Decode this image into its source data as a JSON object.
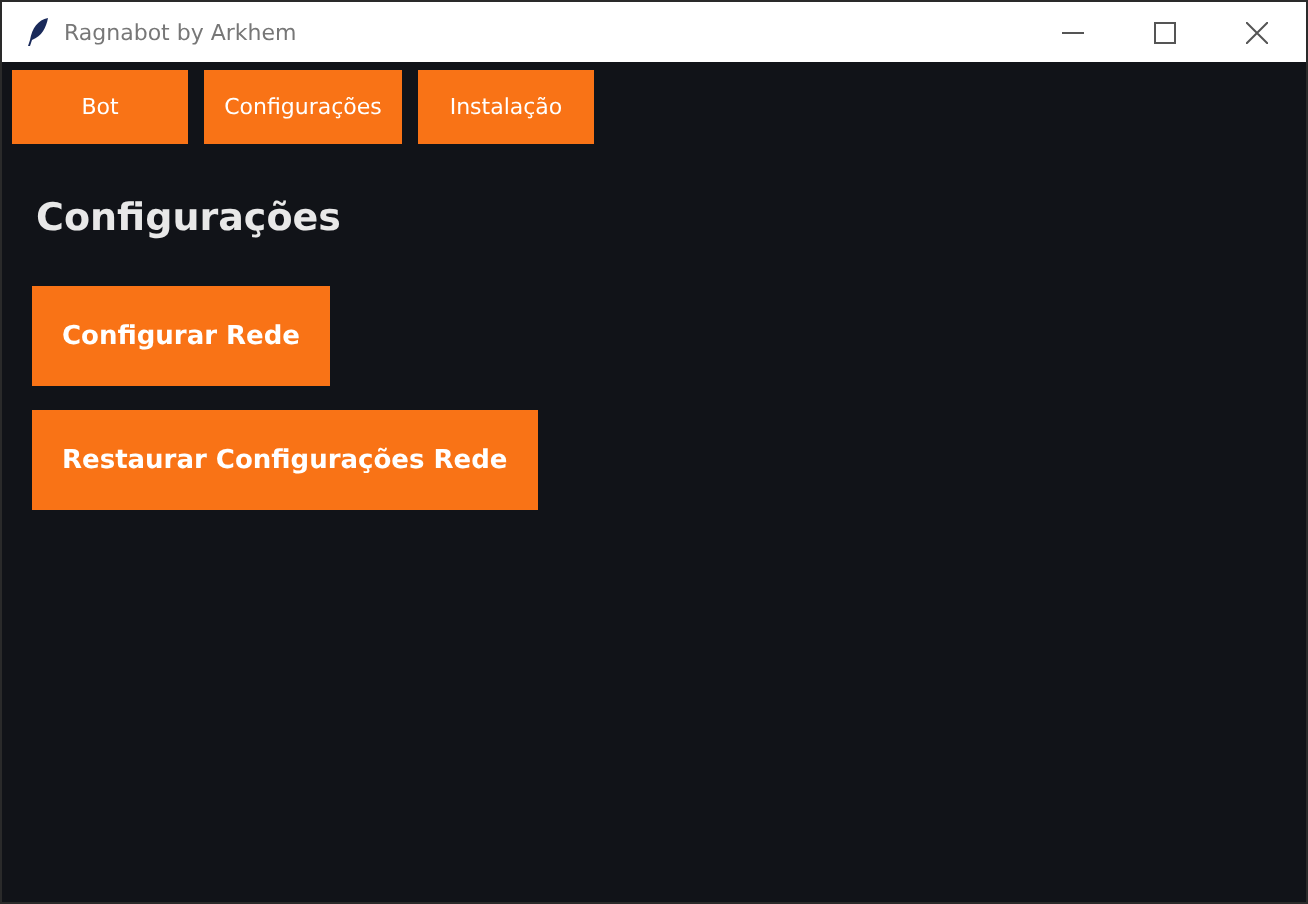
{
  "window": {
    "title": "Ragnabot by Arkhem"
  },
  "tabs": [
    {
      "label": "Bot"
    },
    {
      "label": "Configurações"
    },
    {
      "label": "Instalação"
    }
  ],
  "heading": "Configurações",
  "buttons": [
    {
      "label": "Configurar Rede"
    },
    {
      "label": "Restaurar Configurações Rede"
    }
  ]
}
